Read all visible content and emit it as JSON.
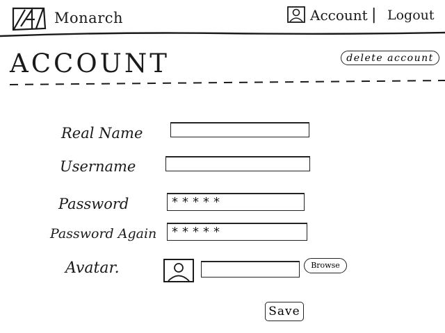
{
  "header": {
    "brand": "Monarch",
    "logo_icon": "monarch-logo-icon",
    "user_icon": "user-icon",
    "account_link": "Account",
    "separator": "|",
    "logout_link": "Logout"
  },
  "page": {
    "title": "ACCOUNT",
    "delete_button": "delete account"
  },
  "form": {
    "real_name": {
      "label": "Real Name",
      "value": ""
    },
    "username": {
      "label": "Username",
      "value": ""
    },
    "password": {
      "label": "Password",
      "value": "*****"
    },
    "password_again": {
      "label": "Password Again",
      "value": "*****"
    },
    "avatar": {
      "label": "Avatar.",
      "icon": "avatar-image-icon",
      "file_value": "",
      "browse_button": "Browse"
    },
    "save_button": "Save"
  }
}
